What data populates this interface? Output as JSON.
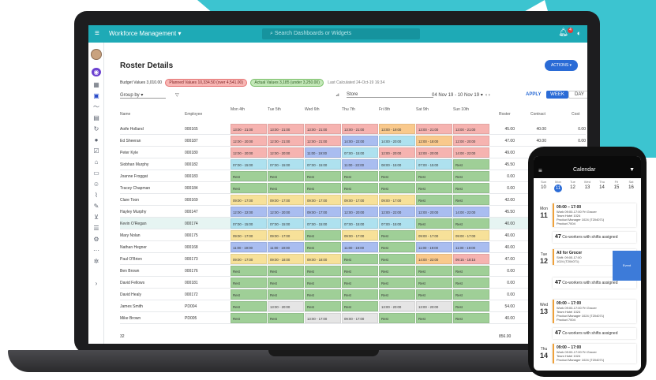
{
  "colors": {
    "topbar": "#1eaab6",
    "accent": "#2a6bd6",
    "shift_red": "#f6b3b0",
    "shift_green": "#a9d7a1",
    "shift_blue": "#a9bdf0",
    "shift_yellow": "#f7e199",
    "shift_lightblue": "#aee1ef",
    "shift_orange": "#f9c98c",
    "rest": "#9fcf97"
  },
  "app": {
    "title": "Workforce Management ▾",
    "search_placeholder": "Search Dashboards or Widgets",
    "notification_count": "4"
  },
  "page": {
    "title": "Roster Details",
    "actions_label": "ACTIONS ▾",
    "budget_label": "Budget Values 3,010.00",
    "planned_label": "Planned Values 10,334.50 (over 4,541.00)",
    "actual_label": "Actual Values 3,185 (under 3,250.00)",
    "last_calc": "Last Calculated 24-Oct-19 16:34"
  },
  "filters": {
    "group_by": "Group by",
    "store": "Store",
    "date_range": "04 Nov 19 - 10 Nov 19",
    "apply": "APPLY",
    "week": "WEEK",
    "day": "DAY"
  },
  "columns": {
    "name": "Name",
    "employee": "Employee",
    "days": [
      "Mon 4th",
      "Tue 5th",
      "Wed 6th",
      "Thu 7th",
      "Fri 8th",
      "Sat 9th",
      "Sun 10th"
    ],
    "roster": "Roster",
    "contract": "Contract",
    "cost": "Cost"
  },
  "rows": [
    {
      "name": "Aoife Holland",
      "emp": "000165",
      "cells": [
        [
          "13:00 - 21:00",
          "r"
        ],
        [
          "13:00 - 21:00",
          "r"
        ],
        [
          "13:00 - 21:00",
          "r"
        ],
        [
          "13:00 - 21:00",
          "r"
        ],
        [
          "13:00 - 19:00",
          "o"
        ],
        [
          "13:00 - 21:00",
          "r"
        ],
        [
          "13:00 - 21:00",
          "r"
        ]
      ],
      "roster": "45.00",
      "contract": "40.00",
      "cost": "0.00"
    },
    {
      "name": "Ed Sheeran",
      "emp": "000187",
      "cells": [
        [
          "12:00 - 20:00",
          "r"
        ],
        [
          "12:00 - 21:00",
          "r"
        ],
        [
          "12:00 - 21:00",
          "r"
        ],
        [
          "14:00 - 22:00",
          "b"
        ],
        [
          "14:00 - 20:00",
          "lb"
        ],
        [
          "12:00 - 18:00",
          "o"
        ],
        [
          "12:00 - 20:00",
          "r"
        ]
      ],
      "roster": "47.00",
      "contract": "40.00",
      "cost": "0.00"
    },
    {
      "name": "Peter Kyle",
      "emp": "000180",
      "cells": [
        [
          "12:00 - 20:00",
          "r"
        ],
        [
          "12:00 - 20:00",
          "r"
        ],
        [
          "11:00 - 19:00",
          "b"
        ],
        [
          "07:00 - 15:00",
          "lb"
        ],
        [
          "12:00 - 20:00",
          "r"
        ],
        [
          "12:00 - 20:00",
          "r"
        ],
        [
          "14:00 - 22:00",
          "r"
        ]
      ],
      "roster": "49.00",
      "contract": "40.00",
      "cost": "0.00"
    },
    {
      "name": "Siobhan Murphy",
      "emp": "000182",
      "cells": [
        [
          "07:00 - 15:00",
          "lb"
        ],
        [
          "07:00 - 15:00",
          "lb"
        ],
        [
          "07:00 - 15:00",
          "lb"
        ],
        [
          "11:00 - 22:00",
          "b"
        ],
        [
          "08:00 - 15:00",
          "lb"
        ],
        [
          "07:00 - 15:00",
          "lb"
        ],
        [
          "Rest",
          "g"
        ]
      ],
      "roster": "45.50",
      "contract": "40.00",
      "cost": "0.00"
    },
    {
      "name": "Joanne Froggat",
      "emp": "000183",
      "cells": [
        [
          "Rest",
          "g"
        ],
        [
          "Rest",
          "g"
        ],
        [
          "Rest",
          "g"
        ],
        [
          "Rest",
          "g"
        ],
        [
          "Rest",
          "g"
        ],
        [
          "Rest",
          "g"
        ],
        [
          "Rest",
          "g"
        ]
      ],
      "roster": "0.00",
      "contract": "0.00",
      "cost": "0.00"
    },
    {
      "name": "Tracey Chapman",
      "emp": "000184",
      "cells": [
        [
          "Rest",
          "g"
        ],
        [
          "Rest",
          "g"
        ],
        [
          "Rest",
          "g"
        ],
        [
          "Rest",
          "g"
        ],
        [
          "Rest",
          "g"
        ],
        [
          "Rest",
          "g"
        ],
        [
          "Rest",
          "g"
        ]
      ],
      "roster": "0.00",
      "contract": "0.00",
      "cost": "0.00"
    },
    {
      "name": "Clare Toon",
      "emp": "000169",
      "cells": [
        [
          "09:00 - 17:00",
          "y"
        ],
        [
          "09:00 - 17:00",
          "y"
        ],
        [
          "09:00 - 17:00",
          "y"
        ],
        [
          "09:00 - 17:00",
          "y"
        ],
        [
          "09:00 - 17:00",
          "y"
        ],
        [
          "Rest",
          "g"
        ],
        [
          "Rest",
          "g"
        ]
      ],
      "roster": "42.00",
      "contract": "0.00",
      "cost": "0.00"
    },
    {
      "name": "Hayley Murphy",
      "emp": "000147",
      "cells": [
        [
          "12:00 - 22:00",
          "b"
        ],
        [
          "12:00 - 20:00",
          "b"
        ],
        [
          "09:00 - 17:00",
          "b"
        ],
        [
          "12:00 - 20:00",
          "b"
        ],
        [
          "12:00 - 22:00",
          "b"
        ],
        [
          "12:00 - 20:00",
          "b"
        ],
        [
          "14:00 - 22:00",
          "b"
        ]
      ],
      "roster": "45.50",
      "contract": "0.00",
      "cost": "0.00"
    },
    {
      "name": "Kevin O'Regan",
      "emp": "000174",
      "cells": [
        [
          "07:00 - 15:00",
          "lb"
        ],
        [
          "07:00 - 15:00",
          "lb"
        ],
        [
          "07:00 - 15:00",
          "lb"
        ],
        [
          "07:00 - 15:00",
          "lb"
        ],
        [
          "07:00 - 15:00",
          "lb"
        ],
        [
          "Rest",
          "g"
        ],
        [
          "Rest",
          "g"
        ]
      ],
      "roster": "40.00",
      "contract": "0.00",
      "cost": "0.00"
    },
    {
      "name": "Mary Nolan",
      "emp": "000175",
      "cells": [
        [
          "09:00 - 17:00",
          "y"
        ],
        [
          "09:00 - 17:00",
          "y"
        ],
        [
          "Rest",
          "g"
        ],
        [
          "09:00 - 17:00",
          "y"
        ],
        [
          "Rest",
          "g"
        ],
        [
          "09:00 - 17:00",
          "y"
        ],
        [
          "09:00 - 17:00",
          "y"
        ]
      ],
      "roster": "40.00",
      "contract": "0.00",
      "cost": "0.00"
    },
    {
      "name": "Nathan Hegner",
      "emp": "000168",
      "cells": [
        [
          "11:00 - 19:00",
          "b"
        ],
        [
          "11:00 - 19:00",
          "b"
        ],
        [
          "Rest",
          "g"
        ],
        [
          "11:00 - 19:00",
          "b"
        ],
        [
          "Rest",
          "g"
        ],
        [
          "11:00 - 19:00",
          "b"
        ],
        [
          "11:00 - 19:00",
          "b"
        ]
      ],
      "roster": "40.00",
      "contract": "0.00",
      "cost": "0.00"
    },
    {
      "name": "Paul O'Brien",
      "emp": "000173",
      "cells": [
        [
          "09:00 - 17:00",
          "y"
        ],
        [
          "09:00 - 18:00",
          "y"
        ],
        [
          "09:00 - 18:00",
          "y"
        ],
        [
          "Rest",
          "g"
        ],
        [
          "Rest",
          "g"
        ],
        [
          "14:00 - 22:00",
          "o"
        ],
        [
          "09:15 - 18:15",
          "r"
        ]
      ],
      "roster": "47.00",
      "contract": "0.00",
      "cost": "0.00"
    },
    {
      "name": "Ben Brown",
      "emp": "000176",
      "cells": [
        [
          "Rest",
          "g"
        ],
        [
          "Rest",
          "g"
        ],
        [
          "Rest",
          "g"
        ],
        [
          "Rest",
          "g"
        ],
        [
          "Rest",
          "g"
        ],
        [
          "Rest",
          "g"
        ],
        [
          "Rest",
          "g"
        ]
      ],
      "roster": "0.00",
      "contract": "0.00",
      "cost": "0.00"
    },
    {
      "name": "David Fellows",
      "emp": "000181",
      "cells": [
        [
          "Rest",
          "g"
        ],
        [
          "Rest",
          "g"
        ],
        [
          "Rest",
          "g"
        ],
        [
          "Rest",
          "g"
        ],
        [
          "Rest",
          "g"
        ],
        [
          "Rest",
          "g"
        ],
        [
          "Rest",
          "g"
        ]
      ],
      "roster": "0.00",
      "contract": "0.00",
      "cost": "0.00"
    },
    {
      "name": "David Healy",
      "emp": "000172",
      "cells": [
        [
          "Rest",
          "g"
        ],
        [
          "Rest",
          "g"
        ],
        [
          "Rest",
          "g"
        ],
        [
          "Rest",
          "g"
        ],
        [
          "Rest",
          "g"
        ],
        [
          "Rest",
          "g"
        ],
        [
          "Rest",
          "g"
        ]
      ],
      "roster": "0.00",
      "contract": "0.00",
      "cost": "0.00"
    },
    {
      "name": "James Smith",
      "emp": "PD004",
      "cells": [
        [
          "Rest",
          "g"
        ],
        [
          "13:00 - 20:00",
          "w"
        ],
        [
          "Rest",
          "g"
        ],
        [
          "Rest",
          "g"
        ],
        [
          "13:00 - 20:00",
          "w"
        ],
        [
          "13:00 - 20:00",
          "w"
        ],
        [
          "Rest",
          "g"
        ]
      ],
      "roster": "54.00",
      "contract": "0.00",
      "cost": "0.00"
    },
    {
      "name": "Mike Brown",
      "emp": "PD005",
      "cells": [
        [
          "Rest",
          "g"
        ],
        [
          "Rest",
          "g"
        ],
        [
          "13:00 - 17:00",
          "w"
        ],
        [
          "09:00 - 17:00",
          "w"
        ],
        [
          "Rest",
          "g"
        ],
        [
          "Rest",
          "g"
        ],
        [
          "Rest",
          "g"
        ]
      ],
      "roster": "40.00",
      "contract": "0.00",
      "cost": "0.00"
    }
  ],
  "totals": {
    "count": "32",
    "roster": "856.00"
  },
  "phone": {
    "title": "Calendar",
    "days": [
      {
        "dow": "Sun",
        "d": "10"
      },
      {
        "dow": "Mon",
        "d": "11"
      },
      {
        "dow": "Tue",
        "d": "12"
      },
      {
        "dow": "Wed",
        "d": "13"
      },
      {
        "dow": "Thu",
        "d": "14"
      },
      {
        "dow": "Fri",
        "d": "15"
      },
      {
        "dow": "Sat",
        "d": "16"
      }
    ],
    "entries": [
      {
        "dow": "Mon",
        "date": "11",
        "time": "09:00 – 17:00",
        "l1": "Work 09:00-17:00 Fri Grocer",
        "l2": "Team Hotel 1024",
        "l3": "Product Manager 1024 (T204071)",
        "l4": "Product 7004"
      },
      {
        "dow": "Tue",
        "date": "12",
        "time": "All for Grocer",
        "l1": "Shift: 09:00-17:00",
        "l2": "1024 (T204071)",
        "l3": "",
        "l4": ""
      },
      {
        "dow": "Wed",
        "date": "13",
        "time": "09:00 – 17:00",
        "l1": "Work 09:00-17:00 Fri Grocer",
        "l2": "Team Hotel 1024",
        "l3": "Product Manager 1024 (T204071)",
        "l4": "Product 7004"
      },
      {
        "dow": "Thu",
        "date": "14",
        "time": "09:00 – 17:00",
        "l1": "Work 09:00-17:00 Fri Grocer",
        "l2": "Team Hotel 1024",
        "l3": "Product Manager 1024 (T204071)",
        "l4": ""
      }
    ],
    "coworkers_num": "47",
    "coworkers_text": "Co-workers with shifts assigned",
    "blue_label": "Event"
  }
}
